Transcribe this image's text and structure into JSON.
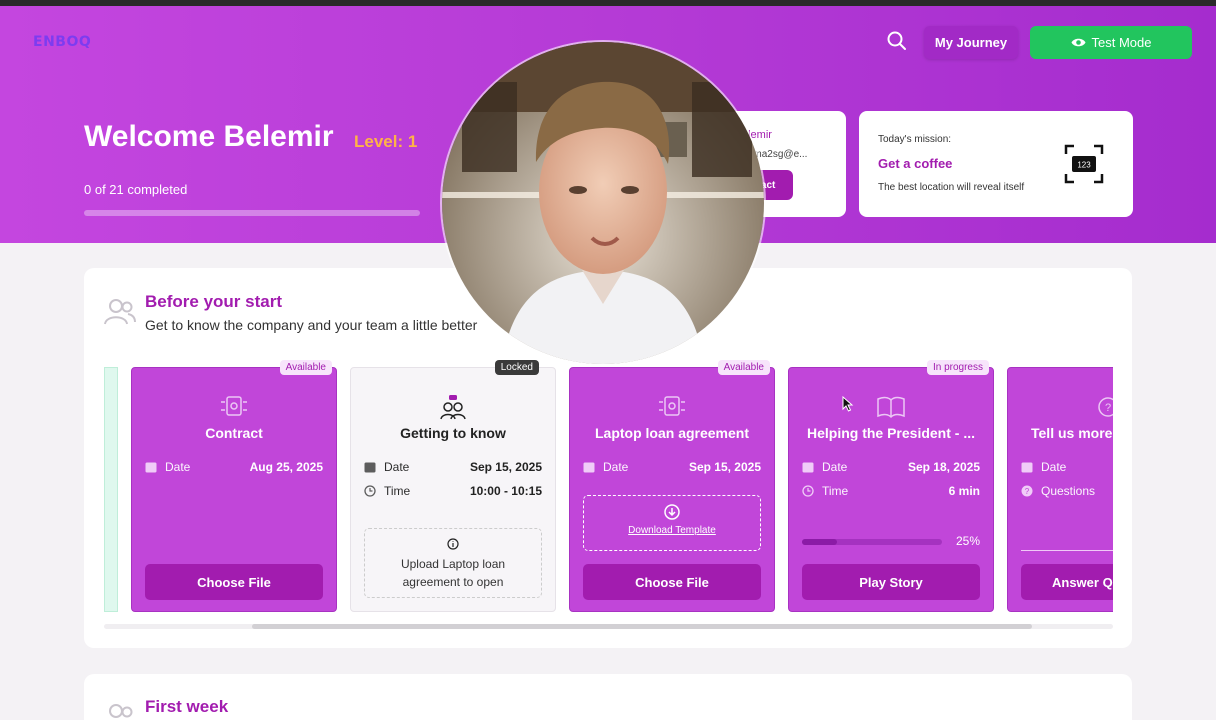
{
  "header": {
    "logo": "ENBOQ",
    "my_journey": "My Journey",
    "test_mode": "Test Mode"
  },
  "hero": {
    "welcome": "Welcome Belemir",
    "level": "Level: 1",
    "completed_text": "0 of 21 completed",
    "progress": 0
  },
  "contact": {
    "name": "elemir",
    "email": "+0ma2sg@e...",
    "button": "tact"
  },
  "mission": {
    "label": "Today's mission:",
    "title": "Get a coffee",
    "subtitle": "The best location will reveal itself"
  },
  "section1": {
    "title": "Before your start",
    "subtitle": "Get to know the company and your team a little better"
  },
  "cards": [
    {
      "title": "Contract",
      "badge": "Available",
      "date_label": "Date",
      "date": "Aug 25, 2025",
      "action": "Choose File"
    },
    {
      "title": "Getting to know",
      "badge": "Locked",
      "date_label": "Date",
      "date": "Sep 15, 2025",
      "time_label": "Time",
      "time": "10:00 - 10:15",
      "locked_msg": "Upload Laptop loan agreement to open"
    },
    {
      "title": "Laptop loan agreement",
      "badge": "Available",
      "date_label": "Date",
      "date": "Sep 15, 2025",
      "download": "Download Template",
      "action": "Choose File"
    },
    {
      "title": "Helping the President - ...",
      "badge": "In progress",
      "date_label": "Date",
      "date": "Sep 18, 2025",
      "time_label": "Time",
      "time": "6 min",
      "progress_text": "25%",
      "progress": 0.25,
      "action": "Play Story"
    },
    {
      "title": "Tell us more",
      "date_label": "Date",
      "questions_label": "Questions",
      "action": "Answer Q"
    }
  ],
  "section2": {
    "title": "First week"
  },
  "colors": {
    "primary": "#a21caf",
    "hero": "#b53bd6",
    "green": "#22c55e",
    "level": "#ffb347"
  }
}
